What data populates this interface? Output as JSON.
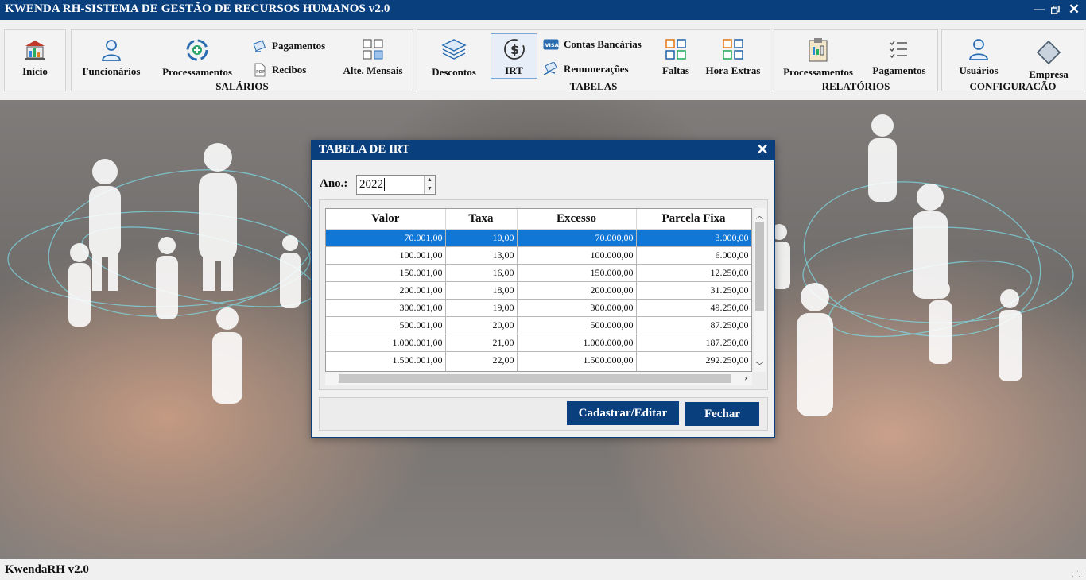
{
  "app": {
    "title": "KWENDA RH-SISTEMA DE GESTÃO DE RECURSOS HUMANOS  v2.0"
  },
  "ribbon": {
    "inicio": "Início",
    "groups": {
      "salarios": "SALÁRIOS",
      "tabelas": "TABELAS",
      "relatorios": "RELATÓRIOS",
      "configuracao": "CONFIGURACÃO"
    },
    "salarios": {
      "funcionarios": "Funcionários",
      "processamentos": "Processamentos",
      "pagamentos": "Pagamentos",
      "recibos": "Recibos",
      "alte_mensais": "Alte. Mensais"
    },
    "tabelas": {
      "descontos": "Descontos",
      "irt": "IRT",
      "contas_bancarias": "Contas Bancárias",
      "remuneracoes": "Remunerações",
      "faltas": "Faltas",
      "hora_extras": "Hora Extras"
    },
    "relatorios": {
      "processamentos": "Processamentos",
      "pagamentos": "Pagamentos"
    },
    "configuracao": {
      "usuarios": "Usuários",
      "empresa": "Empresa"
    }
  },
  "dialog": {
    "title": "TABELA DE IRT",
    "ano_label": "Ano.:",
    "ano_value": "2022",
    "columns": [
      "Valor",
      "Taxa",
      "Excesso",
      "Parcela Fixa"
    ],
    "rows": [
      [
        "70.001,00",
        "10,00",
        "70.000,00",
        "3.000,00"
      ],
      [
        "100.001,00",
        "13,00",
        "100.000,00",
        "6.000,00"
      ],
      [
        "150.001,00",
        "16,00",
        "150.000,00",
        "12.250,00"
      ],
      [
        "200.001,00",
        "18,00",
        "200.000,00",
        "31.250,00"
      ],
      [
        "300.001,00",
        "19,00",
        "300.000,00",
        "49.250,00"
      ],
      [
        "500.001,00",
        "20,00",
        "500.000,00",
        "87.250,00"
      ],
      [
        "1.000.001,00",
        "21,00",
        "1.000.000,00",
        "187.250,00"
      ],
      [
        "1.500.001,00",
        "22,00",
        "1.500.000,00",
        "292.250,00"
      ]
    ],
    "buttons": {
      "save": "Cadastrar/Editar",
      "close": "Fechar"
    }
  },
  "status": {
    "text": "KwendaRH v2.0"
  },
  "colors": {
    "primary": "#0a3f7e",
    "selection": "#1177d6"
  }
}
